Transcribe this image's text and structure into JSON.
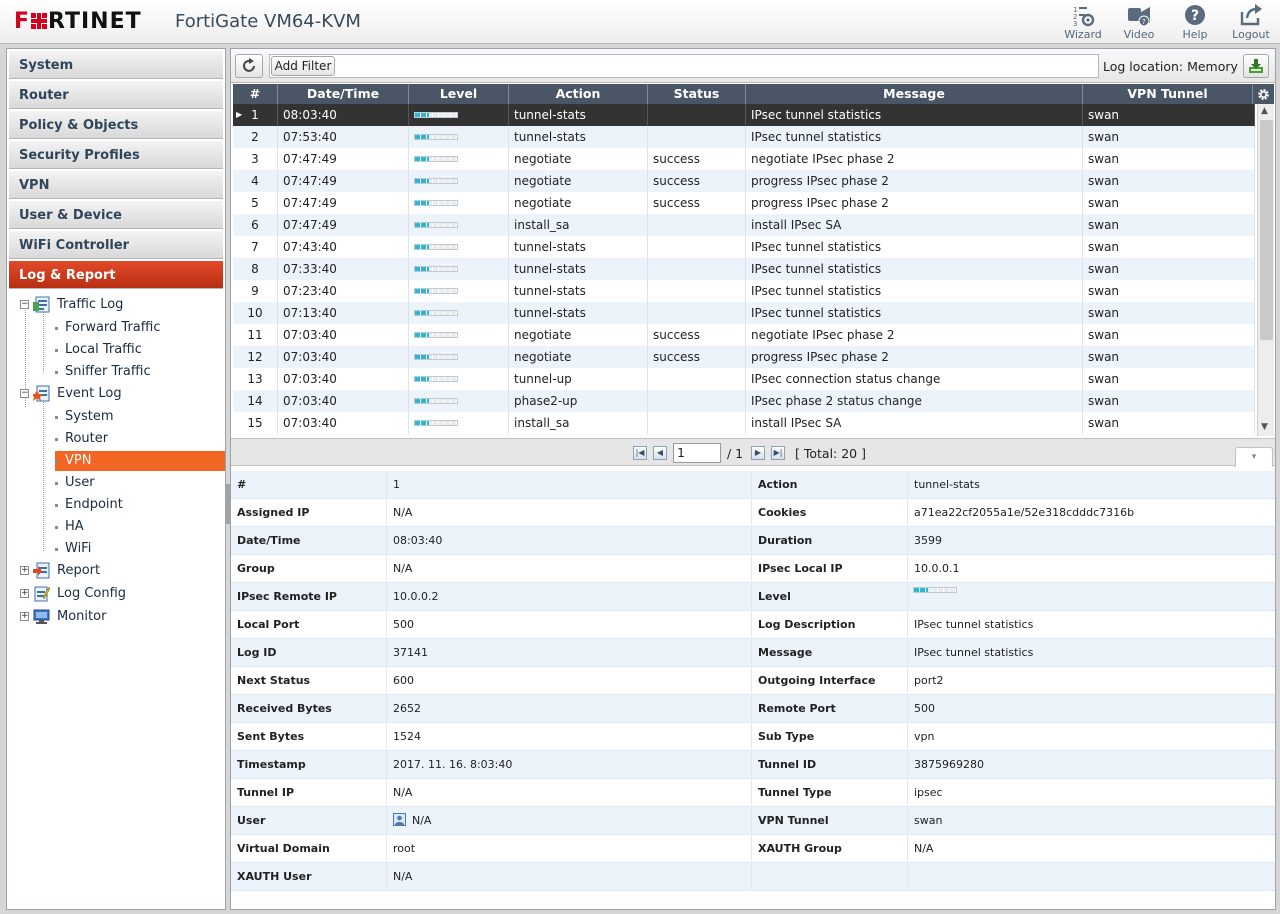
{
  "header": {
    "logo_prefix": "F",
    "logo_rest": "RTINET",
    "device": "FortiGate VM64-KVM",
    "buttons": [
      {
        "id": "wizard",
        "label": "Wizard",
        "icon": "wizard-icon"
      },
      {
        "id": "video",
        "label": "Video",
        "icon": "video-icon"
      },
      {
        "id": "help",
        "label": "Help",
        "icon": "help-icon"
      },
      {
        "id": "logout",
        "label": "Logout",
        "icon": "logout-icon"
      }
    ]
  },
  "sidebar": {
    "sections": [
      {
        "label": "System"
      },
      {
        "label": "Router"
      },
      {
        "label": "Policy & Objects"
      },
      {
        "label": "Security Profiles"
      },
      {
        "label": "VPN"
      },
      {
        "label": "User & Device"
      },
      {
        "label": "WiFi Controller"
      },
      {
        "label": "Log & Report",
        "active": true
      }
    ],
    "tree": {
      "traffic_log": "Traffic Log",
      "forward_traffic": "Forward Traffic",
      "local_traffic": "Local Traffic",
      "sniffer_traffic": "Sniffer Traffic",
      "event_log": "Event Log",
      "system": "System",
      "router": "Router",
      "vpn": "VPN",
      "user": "User",
      "endpoint": "Endpoint",
      "ha": "HA",
      "wifi": "WiFi",
      "report": "Report",
      "log_config": "Log Config",
      "monitor": "Monitor"
    }
  },
  "toolbar": {
    "add_filter": "Add Filter",
    "log_location": "Log location: Memory"
  },
  "grid": {
    "columns": [
      "#",
      "Date/Time",
      "Level",
      "Action",
      "Status",
      "Message",
      "VPN Tunnel"
    ],
    "level_fill": 0.33,
    "rows": [
      {
        "num": "1",
        "time": "08:03:40",
        "action": "tunnel-stats",
        "status": "",
        "message": "IPsec tunnel statistics",
        "tunnel": "swan"
      },
      {
        "num": "2",
        "time": "07:53:40",
        "action": "tunnel-stats",
        "status": "",
        "message": "IPsec tunnel statistics",
        "tunnel": "swan"
      },
      {
        "num": "3",
        "time": "07:47:49",
        "action": "negotiate",
        "status": "success",
        "message": "negotiate IPsec phase 2",
        "tunnel": "swan"
      },
      {
        "num": "4",
        "time": "07:47:49",
        "action": "negotiate",
        "status": "success",
        "message": "progress IPsec phase 2",
        "tunnel": "swan"
      },
      {
        "num": "5",
        "time": "07:47:49",
        "action": "negotiate",
        "status": "success",
        "message": "progress IPsec phase 2",
        "tunnel": "swan"
      },
      {
        "num": "6",
        "time": "07:47:49",
        "action": "install_sa",
        "status": "",
        "message": "install IPsec SA",
        "tunnel": "swan"
      },
      {
        "num": "7",
        "time": "07:43:40",
        "action": "tunnel-stats",
        "status": "",
        "message": "IPsec tunnel statistics",
        "tunnel": "swan"
      },
      {
        "num": "8",
        "time": "07:33:40",
        "action": "tunnel-stats",
        "status": "",
        "message": "IPsec tunnel statistics",
        "tunnel": "swan"
      },
      {
        "num": "9",
        "time": "07:23:40",
        "action": "tunnel-stats",
        "status": "",
        "message": "IPsec tunnel statistics",
        "tunnel": "swan"
      },
      {
        "num": "10",
        "time": "07:13:40",
        "action": "tunnel-stats",
        "status": "",
        "message": "IPsec tunnel statistics",
        "tunnel": "swan"
      },
      {
        "num": "11",
        "time": "07:03:40",
        "action": "negotiate",
        "status": "success",
        "message": "negotiate IPsec phase 2",
        "tunnel": "swan"
      },
      {
        "num": "12",
        "time": "07:03:40",
        "action": "negotiate",
        "status": "success",
        "message": "progress IPsec phase 2",
        "tunnel": "swan"
      },
      {
        "num": "13",
        "time": "07:03:40",
        "action": "tunnel-up",
        "status": "",
        "message": "IPsec connection status change",
        "tunnel": "swan"
      },
      {
        "num": "14",
        "time": "07:03:40",
        "action": "phase2-up",
        "status": "",
        "message": "IPsec phase 2 status change",
        "tunnel": "swan"
      },
      {
        "num": "15",
        "time": "07:03:40",
        "action": "install_sa",
        "status": "",
        "message": "install IPsec SA",
        "tunnel": "swan"
      }
    ]
  },
  "pager": {
    "page": "1",
    "of": "/ 1",
    "total": "[ Total: 20 ]"
  },
  "details": {
    "rows": [
      {
        "k1": "#",
        "v1": "1",
        "k2": "Action",
        "v2": "tunnel-stats"
      },
      {
        "k1": "Assigned IP",
        "v1": "N/A",
        "k2": "Cookies",
        "v2": "a71ea22cf2055a1e/52e318cdddc7316b"
      },
      {
        "k1": "Date/Time",
        "v1": "08:03:40",
        "k2": "Duration",
        "v2": "3599"
      },
      {
        "k1": "Group",
        "v1": "N/A",
        "k2": "IPsec Local IP",
        "v2": "10.0.0.1"
      },
      {
        "k1": "IPsec Remote IP",
        "v1": "10.0.0.2",
        "k2": "Level",
        "v2": ""
      },
      {
        "k1": "Local Port",
        "v1": "500",
        "k2": "Log Description",
        "v2": "IPsec tunnel statistics"
      },
      {
        "k1": "Log ID",
        "v1": "37141",
        "k2": "Message",
        "v2": "IPsec tunnel statistics"
      },
      {
        "k1": "Next Status",
        "v1": "600",
        "k2": "Outgoing Interface",
        "v2": "port2"
      },
      {
        "k1": "Received Bytes",
        "v1": "2652",
        "k2": "Remote Port",
        "v2": "500"
      },
      {
        "k1": "Sent Bytes",
        "v1": "1524",
        "k2": "Sub Type",
        "v2": "vpn"
      },
      {
        "k1": "Timestamp",
        "v1": "2017. 11. 16. 8:03:40",
        "k2": "Tunnel ID",
        "v2": "3875969280"
      },
      {
        "k1": "Tunnel IP",
        "v1": "N/A",
        "k2": "Tunnel Type",
        "v2": "ipsec"
      },
      {
        "k1": "User",
        "v1": "N/A",
        "k2": "VPN Tunnel",
        "v2": "swan"
      },
      {
        "k1": "Virtual Domain",
        "v1": "root",
        "k2": "XAUTH Group",
        "v2": "N/A"
      },
      {
        "k1": "XAUTH User",
        "v1": "N/A",
        "k2": "",
        "v2": ""
      }
    ]
  },
  "colors": {
    "accent": "#d6001c",
    "active_nav": "#c9381a",
    "selected_leaf": "#f26522",
    "grid_header": "#4a5566",
    "level_fill": "#29b8d6"
  }
}
